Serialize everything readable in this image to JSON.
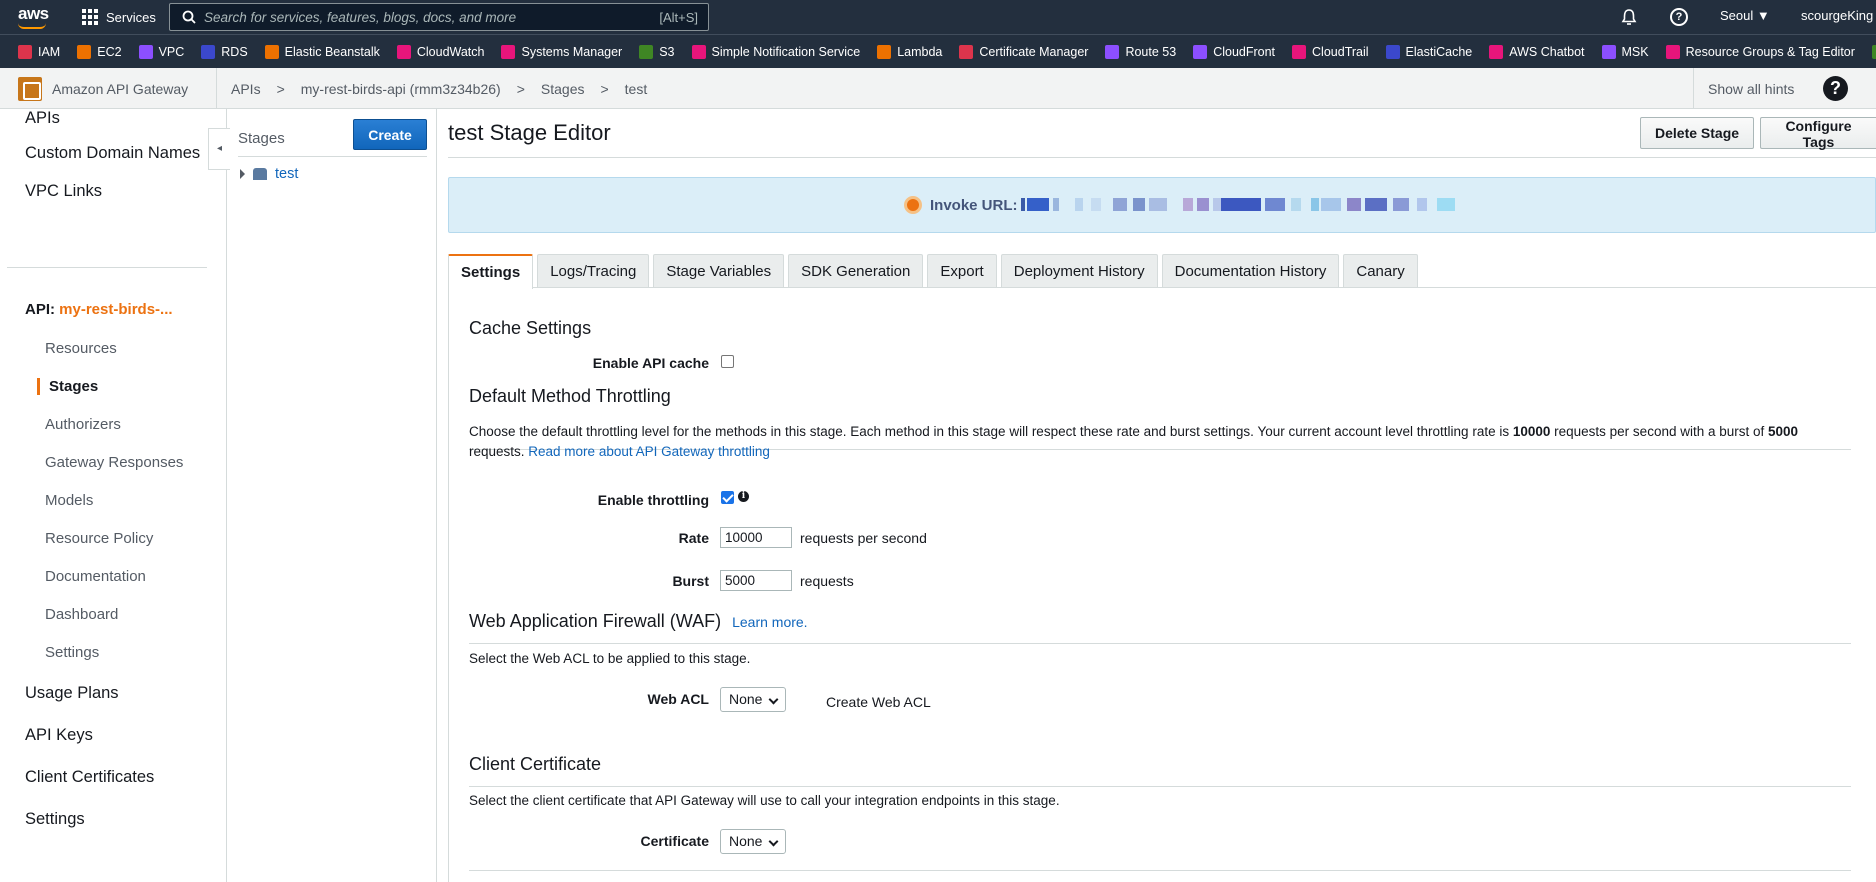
{
  "topnav": {
    "logo": "aws",
    "services_label": "Services",
    "search_placeholder": "Search for services, features, blogs, docs, and more",
    "search_shortcut": "[Alt+S]",
    "region": "Seoul ▼",
    "user": "scourgeKing"
  },
  "favorites": [
    {
      "label": "IAM",
      "color": "#dd344c"
    },
    {
      "label": "EC2",
      "color": "#ed7100"
    },
    {
      "label": "VPC",
      "color": "#8c4fff"
    },
    {
      "label": "RDS",
      "color": "#3b48cc"
    },
    {
      "label": "Elastic Beanstalk",
      "color": "#ed7100"
    },
    {
      "label": "CloudWatch",
      "color": "#e7157b"
    },
    {
      "label": "Systems Manager",
      "color": "#e7157b"
    },
    {
      "label": "S3",
      "color": "#3f8624"
    },
    {
      "label": "Simple Notification Service",
      "color": "#e7157b"
    },
    {
      "label": "Lambda",
      "color": "#ed7100"
    },
    {
      "label": "Certificate Manager",
      "color": "#dd344c"
    },
    {
      "label": "Route 53",
      "color": "#8c4fff"
    },
    {
      "label": "CloudFront",
      "color": "#8c4fff"
    },
    {
      "label": "CloudTrail",
      "color": "#e7157b"
    },
    {
      "label": "ElastiCache",
      "color": "#3b48cc"
    },
    {
      "label": "AWS Chatbot",
      "color": "#e7157b"
    },
    {
      "label": "MSK",
      "color": "#8c4fff"
    },
    {
      "label": "Resource Groups & Tag Editor",
      "color": "#e7157b"
    },
    {
      "label": "",
      "color": "#3f8624"
    }
  ],
  "breadcrumb": {
    "service": "Amazon API Gateway",
    "items": [
      "APIs",
      ">",
      "my-rest-birds-api (rmm3z34b26)",
      ">",
      "Stages",
      ">",
      "test"
    ],
    "show_hints": "Show all hints",
    "help": "?"
  },
  "leftnav": {
    "top": [
      "APIs",
      "Custom Domain Names",
      "VPC Links"
    ],
    "api_prefix": "API:",
    "api_name": "my-rest-birds-...",
    "sub": [
      "Resources",
      "Stages",
      "Authorizers",
      "Gateway Responses",
      "Models",
      "Resource Policy",
      "Documentation",
      "Dashboard",
      "Settings"
    ],
    "bottom": [
      "Usage Plans",
      "API Keys",
      "Client Certificates",
      "Settings"
    ],
    "collapse": "◂"
  },
  "stages_panel": {
    "title": "Stages",
    "create": "Create",
    "tree_item": "test"
  },
  "main": {
    "title": "test Stage Editor",
    "delete_btn": "Delete Stage",
    "tags_btn": "Configure Tags",
    "invoke_label": "Invoke URL: ",
    "tabs": [
      "Settings",
      "Logs/Tracing",
      "Stage Variables",
      "SDK Generation",
      "Export",
      "Deployment History",
      "Documentation History",
      "Canary"
    ],
    "cache": {
      "title": "Cache Settings",
      "enable_label": "Enable API cache",
      "enabled": false
    },
    "throttling": {
      "title": "Default Method Throttling",
      "desc_1": "Choose the default throttling level for the methods in this stage. Each method in this stage will respect these rate and burst settings. Your current account level throttling rate is ",
      "rate_bold": "10000",
      "desc_2": " requests per second with a burst of ",
      "burst_bold": "5000",
      "desc_3": " requests. ",
      "link": "Read more about API Gateway throttling",
      "enable_label": "Enable throttling",
      "enabled": true,
      "info": "i",
      "rate_label": "Rate",
      "rate_value": "10000",
      "rate_unit": "requests per second",
      "burst_label": "Burst",
      "burst_value": "5000",
      "burst_unit": "requests"
    },
    "waf": {
      "title": "Web Application Firewall (WAF)",
      "learn": "Learn more.",
      "desc": "Select the Web ACL to be applied to this stage.",
      "acl_label": "Web ACL",
      "acl_value": "None",
      "create_link": "Create Web ACL"
    },
    "cert": {
      "title": "Client Certificate",
      "desc": "Select the client certificate that API Gateway will use to call your integration endpoints in this stage.",
      "label": "Certificate",
      "value": "None"
    }
  }
}
